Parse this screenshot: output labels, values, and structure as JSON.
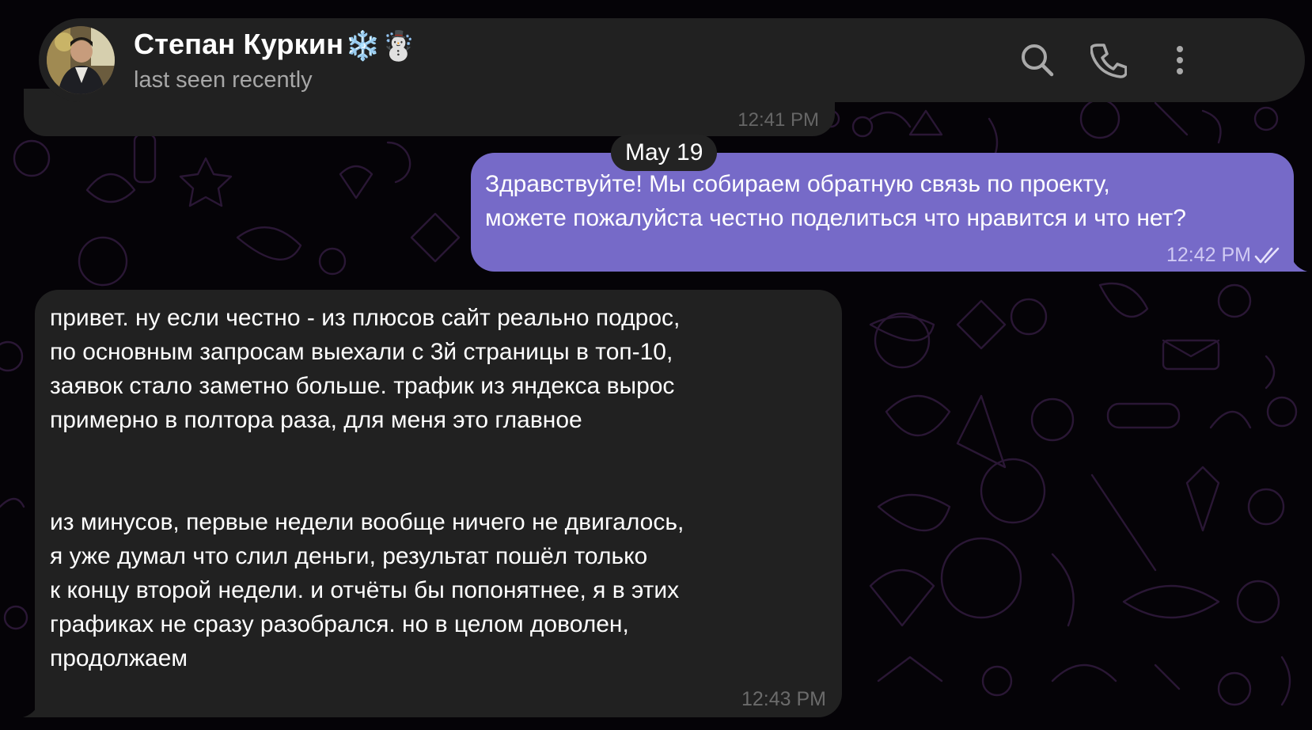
{
  "header": {
    "contact_name": "Степан Куркин",
    "name_emoji": "❄️☃️",
    "status": "last seen recently",
    "actions": [
      {
        "name": "search-button",
        "icon": "search-icon"
      },
      {
        "name": "call-button",
        "icon": "phone-icon"
      },
      {
        "name": "more-button",
        "icon": "more-vertical-icon"
      }
    ]
  },
  "chat": {
    "previous_message_time": "12:41 PM",
    "date_separator": "May 19",
    "outgoing": {
      "lines": [
        "Здравствуйте! Мы собираем обратную связь по проекту,",
        "можете пожалуйста честно поделиться что нравится и что нет?"
      ],
      "time": "12:42 PM",
      "status_icon": "double-check-icon"
    },
    "incoming": {
      "paragraph1": [
        "привет. ну если честно - из плюсов сайт реально подрос,",
        "по основным запросам выехали с 3й страницы в топ-10,",
        "заявок стало заметно больше. трафик из яндекса вырос",
        "примерно в полтора раза, для меня это главное"
      ],
      "paragraph2": [
        "из минусов, первые недели вообще ничего не двигалось,",
        "я уже думал что слил деньги, результат пошёл только",
        "к концу второй недели. и отчёты бы попонятнее, я в этих",
        "графиках не сразу разобрался. но в целом доволен,",
        "продолжаем"
      ],
      "time": "12:43 PM"
    }
  },
  "colors": {
    "background": "#050307",
    "header": "#212121",
    "outgoing_bubble": "#766ac8",
    "incoming_bubble": "#212121",
    "pattern": "#2a1735"
  }
}
